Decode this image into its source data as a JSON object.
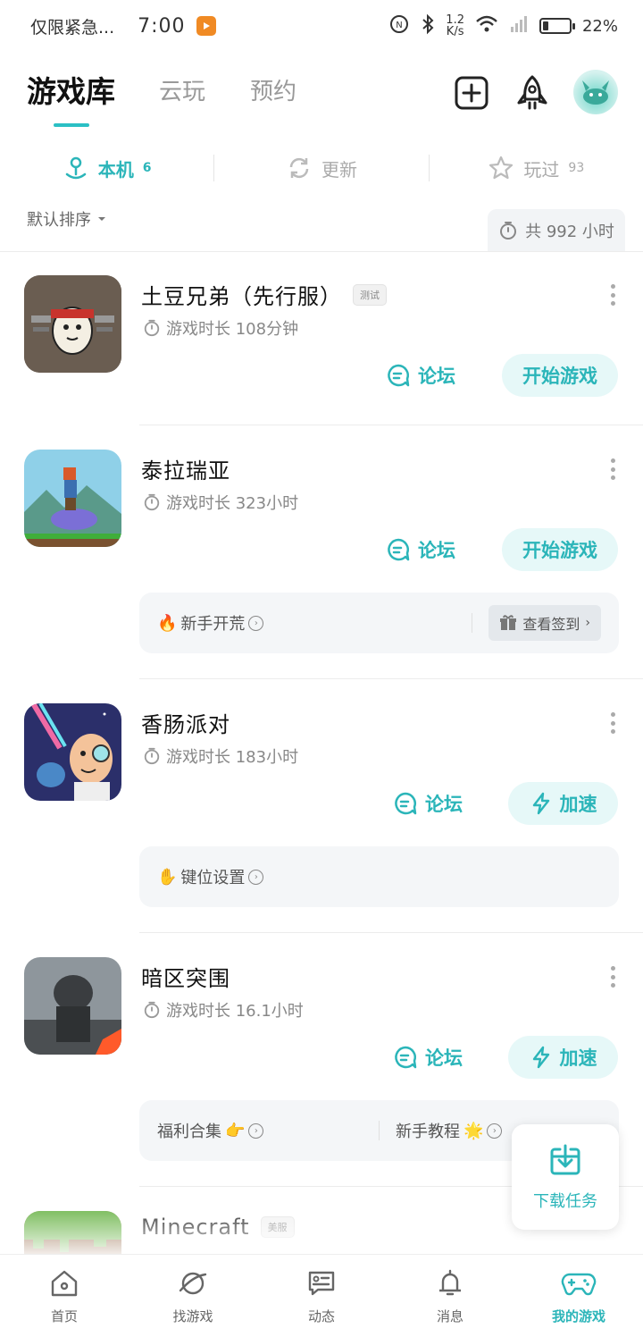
{
  "status_bar": {
    "carrier": "仅限紧急...",
    "time": "7:00",
    "net_speed_top": "1.2",
    "net_speed_bottom": "K/s",
    "battery": "22%",
    "battery_level": 0.22
  },
  "header": {
    "tabs": [
      {
        "label": "游戏库",
        "active": true
      },
      {
        "label": "云玩",
        "active": false
      },
      {
        "label": "预约",
        "active": false
      }
    ]
  },
  "subtabs": [
    {
      "label": "本机",
      "count": "6",
      "icon": "local-icon",
      "active": true
    },
    {
      "label": "更新",
      "count": "",
      "icon": "refresh-icon",
      "active": false
    },
    {
      "label": "玩过",
      "count": "93",
      "icon": "star-icon",
      "active": false
    }
  ],
  "sort": {
    "label": "默认排序"
  },
  "total": {
    "label": "共 992 小时"
  },
  "games": [
    {
      "title": "土豆兄弟（先行服）",
      "badge": "测试",
      "meta": "游戏时长 108分钟",
      "forum": "论坛",
      "primary": "开始游戏",
      "primary_icon": ""
    },
    {
      "title": "泰拉瑞亚",
      "badge": "",
      "meta": "游戏时长 323小时",
      "forum": "论坛",
      "primary": "开始游戏",
      "primary_icon": "",
      "extra": {
        "left": "新手开荒",
        "left_emoji": "🔥",
        "right_button": "查看签到"
      }
    },
    {
      "title": "香肠派对",
      "badge": "",
      "meta": "游戏时长 183小时",
      "forum": "论坛",
      "primary": "加速",
      "primary_icon": "lightning-icon",
      "extra": {
        "left": "键位设置",
        "left_emoji": "✋"
      }
    },
    {
      "title": "暗区突围",
      "badge": "",
      "meta": "游戏时长 16.1小时",
      "forum": "论坛",
      "primary": "加速",
      "primary_icon": "lightning-icon",
      "extra": {
        "left": "福利合集",
        "left_emoji": "👉",
        "right": "新手教程",
        "right_emoji": "🌟"
      }
    },
    {
      "title": "Minecraft",
      "badge": "美服"
    }
  ],
  "download_float": {
    "label": "下载任务"
  },
  "bottom_nav": [
    {
      "label": "首页",
      "icon": "home-icon",
      "active": false
    },
    {
      "label": "找游戏",
      "icon": "planet-icon",
      "active": false
    },
    {
      "label": "动态",
      "icon": "feed-icon",
      "active": false
    },
    {
      "label": "消息",
      "icon": "bell-icon",
      "active": false
    },
    {
      "label": "我的游戏",
      "icon": "gamepad-icon",
      "active": true
    }
  ],
  "colors": {
    "accent": "#2bb5b9",
    "accent_bg": "#e6f8f8"
  }
}
